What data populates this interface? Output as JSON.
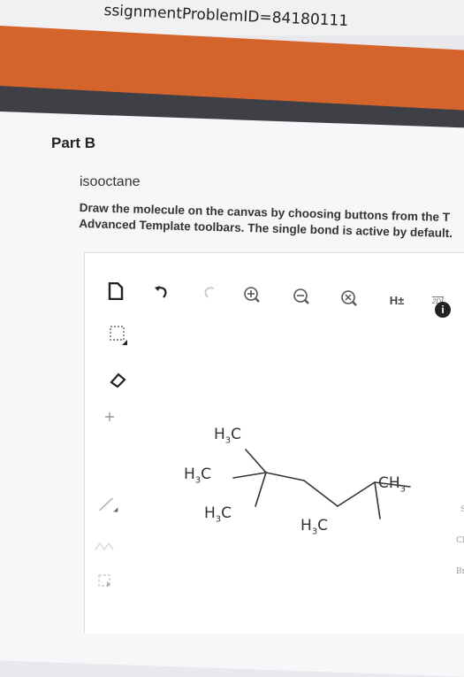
{
  "browser": {
    "url_fragment": "ssignmentProblemID=84180111"
  },
  "part": {
    "title": "Part B",
    "molecule": "isooctane",
    "instructions_line1": "Draw the molecule on the canvas by choosing buttons from the T",
    "instructions_line2": "Advanced Template toolbars. The single bond is active by default."
  },
  "toolbar": {
    "explicit_h_label": "H±",
    "view_2d_label": "2D",
    "info_label": "i"
  },
  "canvas": {
    "labels": {
      "h3c_top": {
        "main": "H",
        "sub": "3",
        "tail": "C"
      },
      "h3c_mid": {
        "main": "H",
        "sub": "3",
        "tail": "C"
      },
      "h3c_low": {
        "main": "H",
        "sub": "3",
        "tail": "C"
      },
      "ch3_right": {
        "main": "CH",
        "sub": "3"
      },
      "h3c_bottom": {
        "main": "H",
        "sub": "3",
        "tail": "C"
      }
    }
  },
  "element_bar": {
    "cl": "Cl",
    "br": "Br",
    "s": "S"
  }
}
